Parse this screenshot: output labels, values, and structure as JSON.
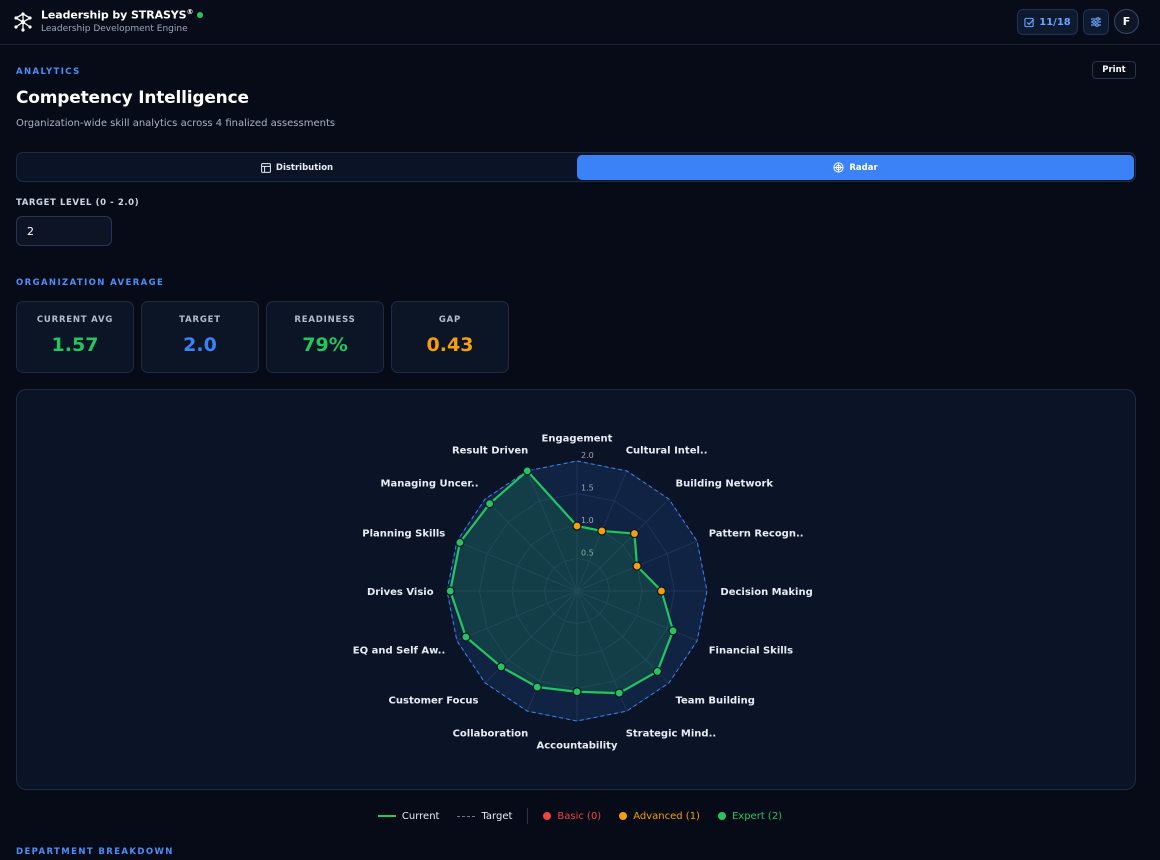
{
  "app": {
    "title": "Leadership by STRASYS",
    "title_mark": "®",
    "subtitle": "Leadership Development Engine",
    "task_counter": "11/18",
    "avatar_initial": "F"
  },
  "page": {
    "eyebrow": "ANALYTICS",
    "title": "Competency Intelligence",
    "subtitle": "Organization-wide skill analytics across 4 finalized assessments",
    "print_label": "Print"
  },
  "view_toggle": {
    "options": [
      {
        "label": "Distribution",
        "icon": "table-icon",
        "active": false
      },
      {
        "label": "Radar",
        "icon": "radar-icon",
        "active": true
      }
    ]
  },
  "target_level": {
    "label": "TARGET LEVEL (0 - 2.0)",
    "value": "2"
  },
  "org_average": {
    "section_label": "ORGANIZATION AVERAGE",
    "cards": [
      {
        "label": "CURRENT AVG",
        "value": "1.57",
        "color": "#22c55e"
      },
      {
        "label": "TARGET",
        "value": "2.0",
        "color": "#3b82f6"
      },
      {
        "label": "READINESS",
        "value": "79%",
        "color": "#22c55e"
      },
      {
        "label": "GAP",
        "value": "0.43",
        "color": "#f59e0b"
      }
    ]
  },
  "chart_data": {
    "type": "radar",
    "axes": [
      "Engagement",
      "Cultural Intel..",
      "Building Network",
      "Pattern Recogn..",
      "Decision Making",
      "Financial Skills",
      "Team Building",
      "Strategic Mind..",
      "Accountability",
      "Collaboration",
      "Customer Focus",
      "EQ and Self Aw..",
      "Drives Visio",
      "Planning Skills",
      "Managing Uncer..",
      "Result Driven"
    ],
    "radial_ticks": [
      "0.5",
      "1.0",
      "1.5",
      "2.0"
    ],
    "rmax": 2.0,
    "series": [
      {
        "name": "Current",
        "values": [
          1.0,
          1.0,
          1.25,
          1.0,
          1.3,
          1.6,
          1.75,
          1.7,
          1.55,
          1.6,
          1.65,
          1.85,
          1.95,
          1.95,
          1.9,
          2.0
        ],
        "color": "#22c55e"
      },
      {
        "name": "Target",
        "values": [
          2,
          2,
          2,
          2,
          2,
          2,
          2,
          2,
          2,
          2,
          2,
          2,
          2,
          2,
          2,
          2
        ],
        "color": "#3b82f6"
      }
    ]
  },
  "legend": {
    "current": "Current",
    "target": "Target",
    "basic": {
      "label": "Basic (0)",
      "color": "#ef4444"
    },
    "advanced": {
      "label": "Advanced (1)",
      "color": "#f59e0b"
    },
    "expert": {
      "label": "Expert (2)",
      "color": "#22c55e"
    }
  },
  "department": {
    "section_label": "DEPARTMENT BREAKDOWN"
  }
}
